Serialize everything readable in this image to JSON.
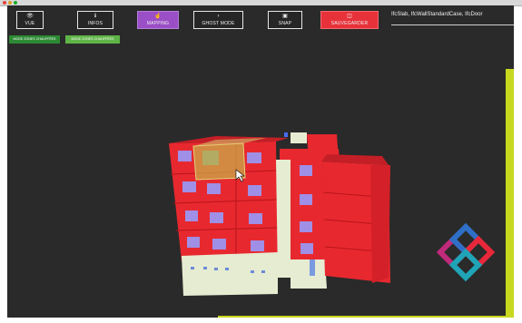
{
  "toolbar": {
    "buttons": [
      {
        "id": "vue",
        "label": "VUE",
        "icon": "eye-icon"
      },
      {
        "id": "infos",
        "label": "INFOS",
        "icon": "info-icon"
      },
      {
        "id": "mapping",
        "label": "MAPPING",
        "icon": "hand-pointer-icon"
      },
      {
        "id": "ghost",
        "label": "GHOST MODE",
        "icon": "chevron-right-icon"
      },
      {
        "id": "snap",
        "label": "SNAP",
        "icon": "image-icon"
      },
      {
        "id": "sauvegarder",
        "label": "SAUVEGARDER",
        "icon": "save-icon"
      }
    ]
  },
  "filters": {
    "text": "IfcSlab, IfcWallStandardCase, IfcDoor"
  },
  "modes": {
    "dark": "MODE ZONES CHAUFFÉES",
    "light": "MODE ZONES CHAUFFÉES"
  },
  "colors": {
    "background": "#2a2a2a",
    "accent_purple": "#9b4fc6",
    "accent_red": "#e8323a",
    "building_red": "#e8282f",
    "window": "#9f8fe6",
    "ground_floor": "#e6ecd2",
    "selection": "#c9b24a",
    "lime": "#c8d81e"
  }
}
